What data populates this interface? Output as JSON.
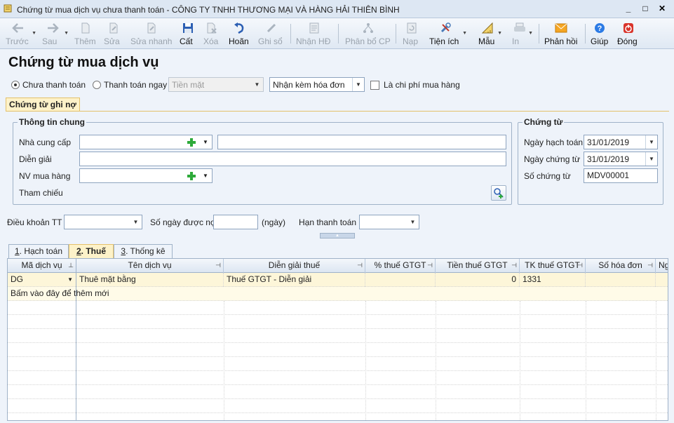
{
  "window": {
    "title": "Chứng từ mua dịch vụ chưa thanh toán - CÔNG TY TNHH THƯƠNG MẠI VÀ HÀNG HẢI THIÊN BÌNH",
    "minimize": "_",
    "maximize": "□",
    "close": "✕"
  },
  "toolbar": {
    "prev": "Trước",
    "next": "Sau",
    "add": "Thêm",
    "edit": "Sửa",
    "quick_edit": "Sửa nhanh",
    "save": "Cất",
    "delete": "Xóa",
    "undo": "Hoãn",
    "post": "Ghi sổ",
    "receive_invoice": "Nhận HĐ",
    "allocate_cost": "Phân bổ CP",
    "load": "Nạp",
    "utilities": "Tiện ích",
    "template": "Mẫu",
    "print": "In",
    "feedback": "Phản hồi",
    "help": "Giúp",
    "close": "Đóng"
  },
  "page_title": "Chứng từ mua dịch vụ",
  "payment": {
    "unpaid_label": "Chưa thanh toán",
    "paid_now_label": "Thanh toán ngay",
    "method_value": "Tiền mặt",
    "invoice_option": "Nhận kèm hóa đơn",
    "expense_checkbox": "Là chi phí mua hàng"
  },
  "main_tab": "Chứng từ ghi nợ",
  "general_info": {
    "group_title": "Thông tin chung",
    "supplier_label": "Nhà cung cấp",
    "supplier_code": "",
    "supplier_name": "",
    "description_label": "Diễn giải",
    "description_value": "",
    "purchaser_label": "NV mua hàng",
    "purchaser_value": "",
    "reference_label": "Tham chiếu"
  },
  "voucher": {
    "group_title": "Chứng từ",
    "posting_date_label": "Ngày hạch toán",
    "posting_date": "31/01/2019",
    "voucher_date_label": "Ngày chứng từ",
    "voucher_date": "31/01/2019",
    "voucher_no_label": "Số chứng từ",
    "voucher_no": "MDV00001"
  },
  "terms": {
    "terms_label": "Điều khoản TT",
    "terms_value": "",
    "days_label": "Số ngày được nợ",
    "days_value": "",
    "days_unit": "(ngày)",
    "due_label": "Hạn thanh toán",
    "due_value": ""
  },
  "detail_tabs": [
    {
      "key": "1",
      "rest": ". Hạch toán"
    },
    {
      "key": "2",
      "rest": ". Thuế"
    },
    {
      "key": "3",
      "rest": ". Thống kê"
    }
  ],
  "grid": {
    "columns": [
      "Mã dịch vụ",
      "Tên dịch vụ",
      "Diễn giải thuế",
      "% thuế GTGT",
      "Tiền thuế GTGT",
      "TK thuế GTGT",
      "Số hóa đơn",
      "Ng"
    ],
    "rows": [
      {
        "code": "DG",
        "name": "Thuê mặt bằng",
        "tax_desc": "Thuế GTGT - Diễn giải",
        "tax_rate": "",
        "tax_amount": "0",
        "tax_account": "1331",
        "invoice_no": ""
      }
    ],
    "add_new_hint": "Bấm vào đây để thêm mới"
  }
}
